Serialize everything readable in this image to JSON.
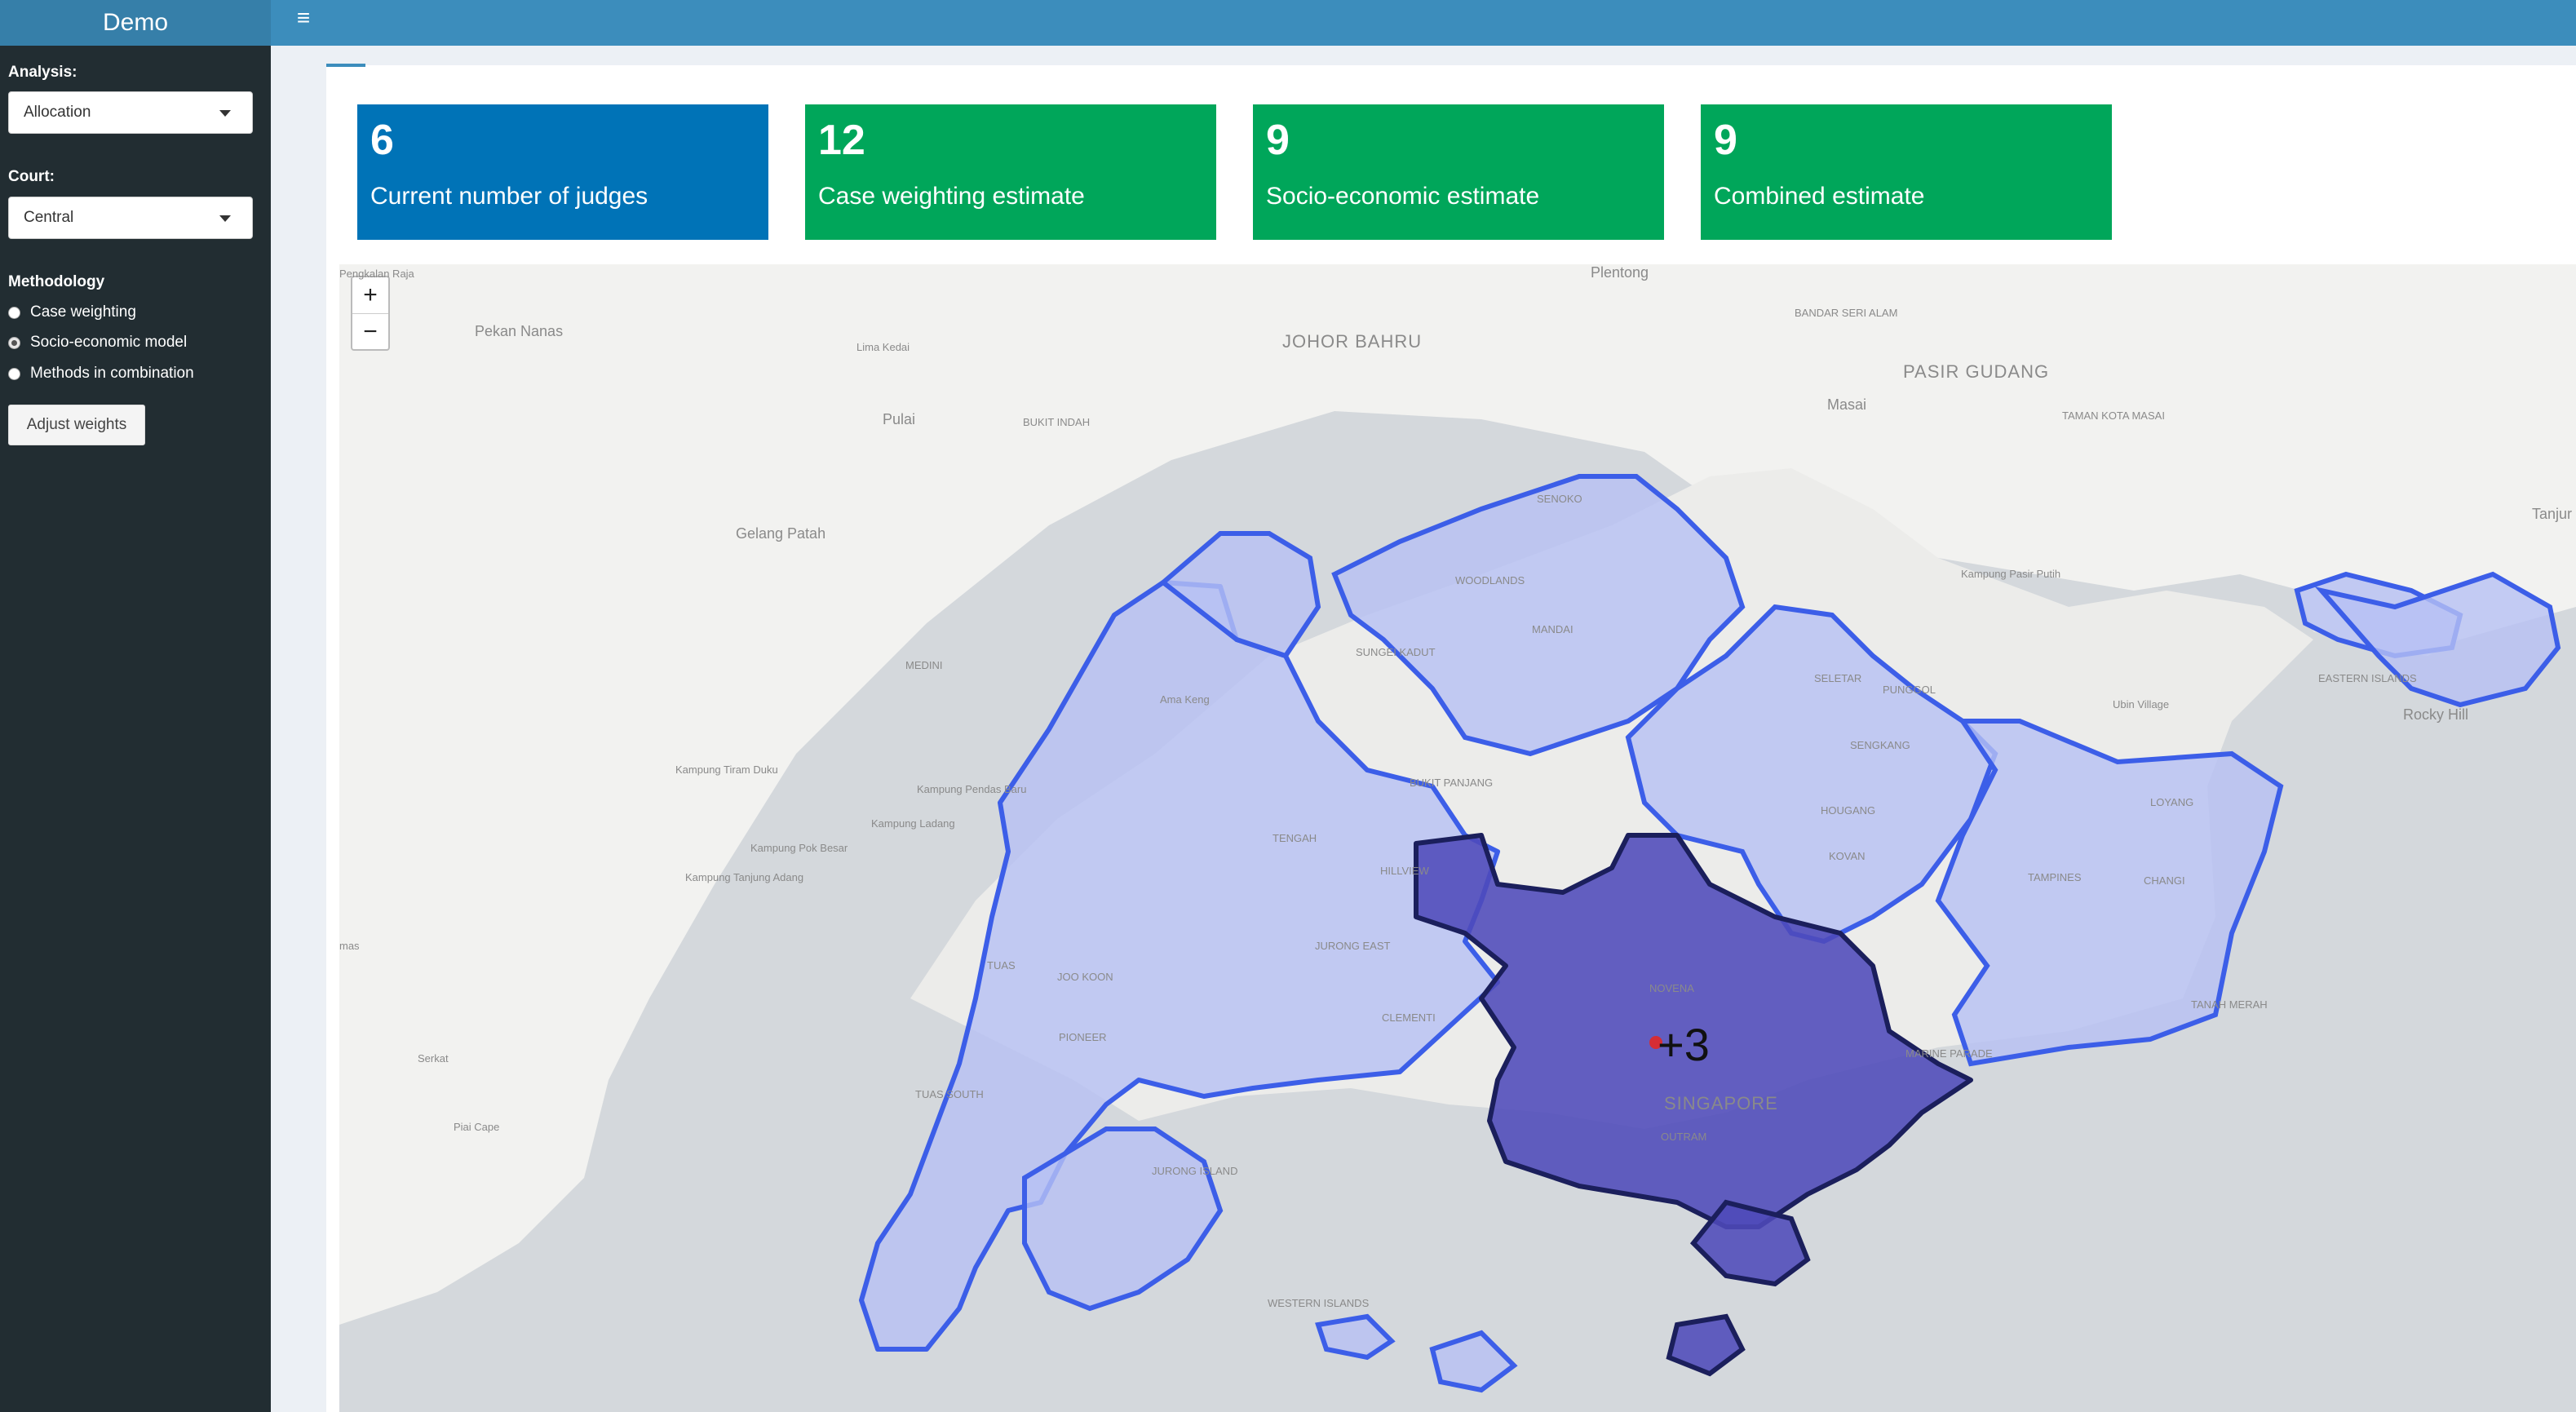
{
  "header": {
    "title": "Demo"
  },
  "sidebar": {
    "analysis": {
      "label": "Analysis:",
      "value": "Allocation"
    },
    "court": {
      "label": "Court:",
      "value": "Central"
    },
    "methodology": {
      "label": "Methodology",
      "options": [
        "Case weighting",
        "Socio-economic model",
        "Methods in combination"
      ],
      "selected": "Socio-economic model"
    },
    "adjust_button": "Adjust weights"
  },
  "value_boxes": [
    {
      "value": "6",
      "label": "Current number of judges",
      "color": "#0073b7"
    },
    {
      "value": "12",
      "label": "Case weighting estimate",
      "color": "#00a65a"
    },
    {
      "value": "9",
      "label": "Socio-economic estimate",
      "color": "#00a65a"
    },
    {
      "value": "9",
      "label": "Combined estimate",
      "color": "#00a65a"
    }
  ],
  "map": {
    "zoom_in": "+",
    "zoom_out": "−",
    "cluster_label": "+3",
    "places": {
      "johor_bahru": "JOHOR BAHRU",
      "pasir_gudang": "PASIR GUDANG",
      "pulai": "Pulai",
      "gelang_patah": "Gelang Patah",
      "pekan_nanas": "Pekan Nanas",
      "lima_kedai": "Lima Kedai",
      "plentong": "Plentong",
      "masai": "Masai",
      "pengkalan_raja": "Pengkalan Raja",
      "bukit_indah": "BUKIT INDAH",
      "bandar_seri_alam": "BANDAR SERI ALAM",
      "taman_kota_masai": "TAMAN KOTA MASAI",
      "kampung_pasir_putih": "Kampung Pasir Putih",
      "tanjung": "Tanjur",
      "medini": "MEDINI",
      "kampung_tiram_duku": "Kampung Tiram Duku",
      "kampung_pendas_baru": "Kampung Pendas Baru",
      "kampung_ladang": "Kampung Ladang",
      "kampung_pok_besar": "Kampung Pok Besar",
      "kampung_tanjung_adang": "Kampung Tanjung Adang",
      "serkat": "Serkat",
      "piai_cape": "Piai Cape",
      "mas": "mas",
      "singapore": "SINGAPORE",
      "senoko": "SENOKO",
      "woodlands": "WOODLANDS",
      "mandai": "MANDAI",
      "sungei_kadut": "SUNGEI KADUT",
      "ama_keng": "Ama Keng",
      "seletar": "SELETAR",
      "punggol": "PUNGGOL",
      "sengkang": "SENGKANG",
      "hougang": "HOUGANG",
      "kovan": "KOVAN",
      "bukit_panjang": "BUKIT PANJANG",
      "tengah": "TENGAH",
      "hillview": "HILLVIEW",
      "jurong_east": "JURONG EAST",
      "clementi": "CLEMENTI",
      "tuas": "TUAS",
      "joo_koon": "JOO KOON",
      "pioneer": "PIONEER",
      "tuas_south": "TUAS SOUTH",
      "jurong_island": "JURONG ISLAND",
      "novena": "NOVENA",
      "outram": "OUTRAM",
      "tampines": "TAMPINES",
      "changi": "CHANGI",
      "loyang": "LOYANG",
      "tanah_merah": "TANAH MERAH",
      "ubin_village": "Ubin Village",
      "rocky_hill": "Rocky Hill",
      "eastern_islands": "EASTERN ISLANDS",
      "western_islands": "WESTERN ISLANDS",
      "marine_parade": "MARINE PARADE"
    }
  }
}
